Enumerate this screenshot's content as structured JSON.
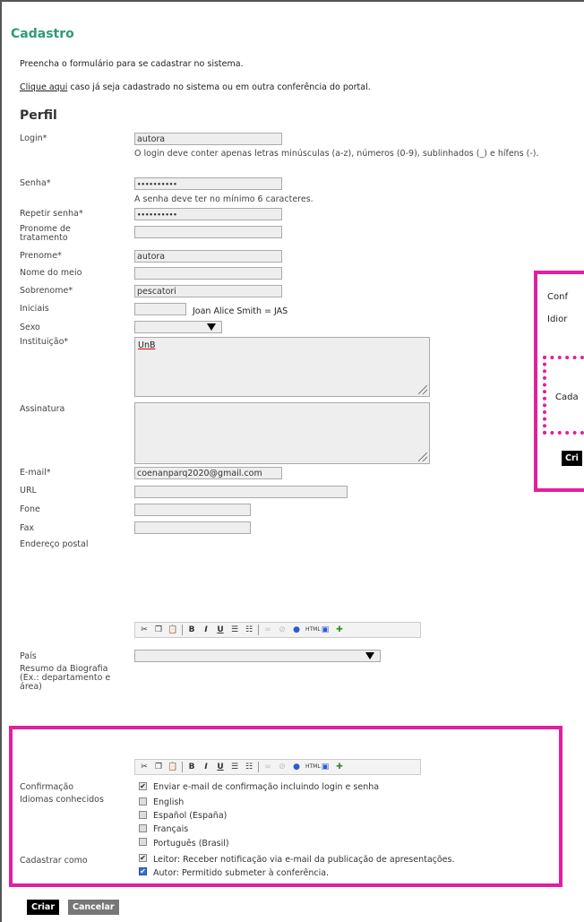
{
  "page": {
    "title": "Cadastro",
    "intro": "Preencha o formulário para se cadastrar no sistema.",
    "already_link": "Clique aqui",
    "already_text": " caso já seja cadastrado no sistema ou em outra conferência do portal."
  },
  "profile": {
    "heading": "Perfil",
    "login_label": "Login*",
    "login_value": "autora",
    "login_help": "O login deve conter apenas letras minúsculas (a-z), números (0-9), sublinhados (_) e hífens (-).",
    "password_label": "Senha*",
    "password_value": "••••••••••",
    "password_help": "A senha deve ter no mínimo 6 caracteres.",
    "repeat_label": "Repetir senha*",
    "repeat_value": "••••••••••",
    "pronoun_label": "Pronome de tratamento",
    "firstname_label": "Prenome*",
    "firstname_value": "autora",
    "middlename_label": "Nome do meio",
    "lastname_label": "Sobrenome*",
    "lastname_value": "pescatori",
    "initials_label": "Iniciais",
    "initials_example": "Joan Alice Smith = JAS",
    "sex_label": "Sexo",
    "institution_label": "Instituição*",
    "institution_value": "UnB",
    "signature_label": "Assinatura",
    "email_label": "E-mail*",
    "email_value": "coenanparq2020@gmail.com",
    "url_label": "URL",
    "phone_label": "Fone",
    "fax_label": "Fax",
    "address_label": "Endereço postal",
    "country_label": "País",
    "bio_label": "Resumo da Biografia (Ex.: departamento e área)"
  },
  "settings": {
    "confirmation_label": "Confirmação",
    "confirmation_option": "Enviar e-mail de confirmação incluindo login e senha",
    "languages_label": "Idiomas conhecidos",
    "languages": [
      "English",
      "Español (España)",
      "Français",
      "Português (Brasil)"
    ],
    "register_as_label": "Cadastrar como",
    "reader_option": "Leitor: Receber notificação via e-mail da publicação de apresentações.",
    "author_option": "Autor: Permitido submeter à conferência."
  },
  "zoom_callout": {
    "line1": "Conf",
    "line2": "Idior",
    "line3": "Cada",
    "button": "Cri"
  },
  "buttons": {
    "create": "Criar",
    "cancel": "Cancelar"
  },
  "colors": {
    "title": "#2e9a7a",
    "highlight": "#e020a0"
  }
}
